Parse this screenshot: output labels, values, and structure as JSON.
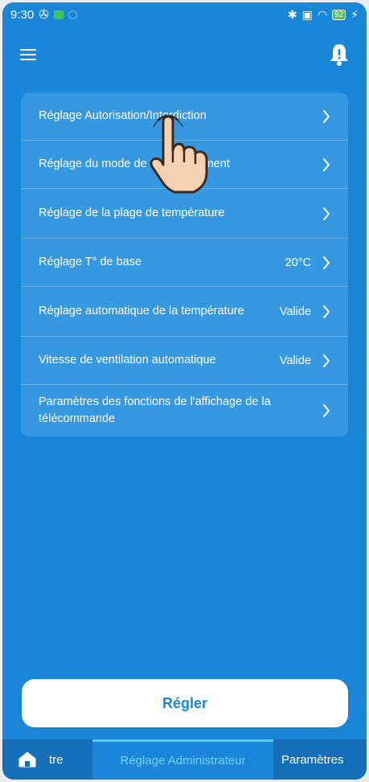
{
  "status_bar": {
    "time": "9:30",
    "battery": "92"
  },
  "menu_items": [
    {
      "label": "Réglage Autorisation/Interdiction",
      "value": ""
    },
    {
      "label": "Réglage du mode de fonctionnement",
      "value": ""
    },
    {
      "label": "Réglage de la plage de température",
      "value": ""
    },
    {
      "label": "Réglage T° de base",
      "value": "20°C"
    },
    {
      "label": "Réglage automatique de la température",
      "value": "Valide"
    },
    {
      "label": "Vitesse de ventilation automatique",
      "value": "Valide"
    },
    {
      "label": "Paramètres des fonctions de l'affichage de la télécommande",
      "value": ""
    }
  ],
  "button": {
    "regler_label": "Régler"
  },
  "bottom_nav": {
    "home_label": "tre",
    "admin_label": "Réglage Administrateur",
    "params_label": "Paramètres"
  },
  "colors": {
    "background": "#1a86d8",
    "card": "#3598e0",
    "active_tab_text": "#79d0f5"
  },
  "icons": [
    "menu-icon",
    "bell-icon",
    "chevron-right-icon",
    "home-icon",
    "pointing-hand-icon"
  ]
}
